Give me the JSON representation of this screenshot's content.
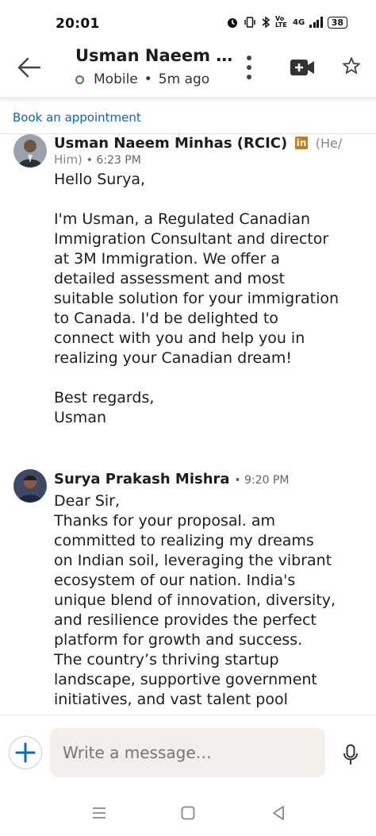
{
  "status_bar": {
    "time": "20:01",
    "network_label": "4G",
    "volte_label": "Vo LTE",
    "battery": "38"
  },
  "header": {
    "title": "Usman Naeem …",
    "presence": "Mobile",
    "last_seen": "5m ago"
  },
  "appointment_link": "Book an appointment",
  "messages": [
    {
      "sender": "Usman Naeem Minhas (RCIC)",
      "badge": "in",
      "pronouns_start": "(He/",
      "pronouns_end": "Him)",
      "time": "6:23 PM",
      "lines": [
        "Hello Surya,",
        "",
        "I'm Usman, a Regulated Canadian",
        "Immigration Consultant and director",
        "at 3M Immigration. We offer a",
        "detailed assessment and most",
        "suitable solution for your immigration",
        "to Canada. I'd be delighted to",
        "connect with you and help you in",
        "realizing your Canadian dream!",
        "",
        "Best regards,",
        "Usman"
      ]
    },
    {
      "sender": "Surya Prakash Mishra",
      "time": "9:20 PM",
      "lines": [
        "Dear Sir,",
        "Thanks for your proposal. am",
        "committed to realizing my dreams",
        "on Indian soil, leveraging the vibrant",
        "ecosystem of our nation. India's",
        "unique blend of innovation, diversity,",
        "and resilience provides the perfect",
        "platform for growth and success.",
        "The country’s thriving startup",
        "landscape, supportive government",
        "initiatives, and vast talent pool"
      ]
    }
  ],
  "compose": {
    "placeholder": "Write a message…"
  },
  "colors": {
    "link": "#0a66c2",
    "linkedin_badge": "#c37d16",
    "presence_dot": "#3a8a3a",
    "input_bg": "#f2efea"
  },
  "icons": {
    "back": "arrow-left-icon",
    "more": "kebab-icon",
    "video": "video-plus-icon",
    "star": "star-icon",
    "plus": "plus-icon",
    "mic": "mic-icon"
  }
}
